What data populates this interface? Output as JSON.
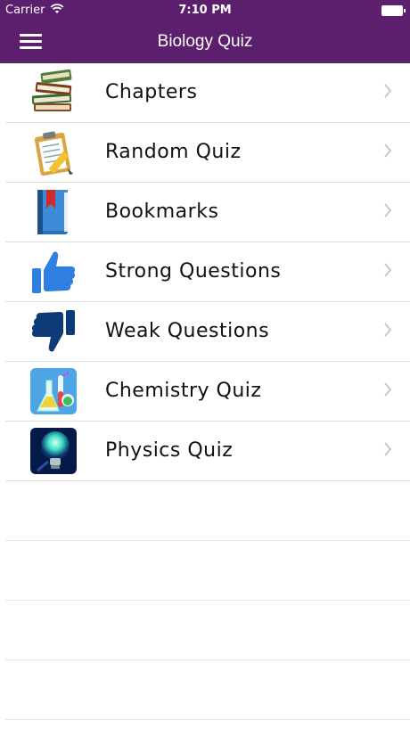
{
  "status_bar": {
    "carrier": "Carrier",
    "time": "7:10 PM",
    "wifi_icon": "wifi-icon",
    "battery_icon": "battery-icon"
  },
  "nav": {
    "title": "Biology Quiz",
    "menu_icon": "hamburger-menu-icon",
    "bar_color": "#5b1f6e"
  },
  "menu_items": [
    {
      "label": "Chapters",
      "icon": "books-icon"
    },
    {
      "label": "Random Quiz",
      "icon": "clipboard-pencil-icon"
    },
    {
      "label": "Bookmarks",
      "icon": "bookmark-book-icon"
    },
    {
      "label": "Strong Questions",
      "icon": "thumbs-up-icon"
    },
    {
      "label": "Weak Questions",
      "icon": "thumbs-down-icon"
    },
    {
      "label": "Chemistry Quiz",
      "icon": "lab-flasks-icon"
    },
    {
      "label": "Physics Quiz",
      "icon": "glowing-bulb-icon"
    }
  ],
  "colors": {
    "accent": "#5b1f6e",
    "thumbs_up": "#2f7fe0",
    "thumbs_down": "#0d3b78",
    "chevron": "#c7c7cc"
  }
}
